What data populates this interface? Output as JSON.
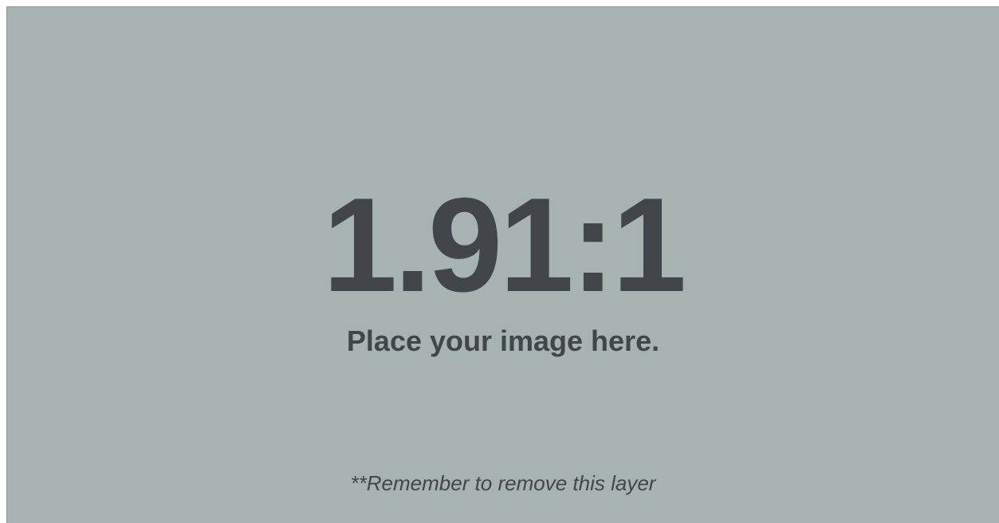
{
  "placeholder": {
    "ratio_text": "1.91:1",
    "caption": "Place your image here.",
    "note": "**Remember to remove this layer"
  },
  "colors": {
    "background": "#a7b2b2",
    "text": "#42464b",
    "border": "#8a9494"
  }
}
